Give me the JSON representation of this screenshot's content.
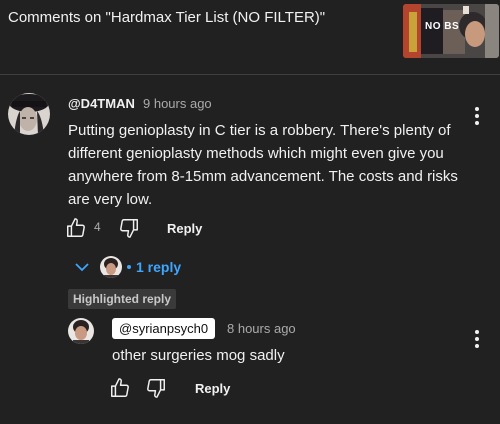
{
  "header": {
    "title": "Comments on \"Hardmax Tier List (NO FILTER)\"",
    "thumbnail_text": "NO BS"
  },
  "comment": {
    "author": "@D4TMAN",
    "time": "9 hours ago",
    "text": "Putting genioplasty in C tier is a robbery.  There's plenty of different genioplasty methods which might even give you anywhere from 8-15mm advancement. The costs and risks are very low.",
    "like_count": "4",
    "reply_label": "Reply",
    "replies_label": "1 reply"
  },
  "reply": {
    "badge": "Highlighted reply",
    "author": "@syrianpsych0",
    "time": "8 hours ago",
    "text": "other surgeries mog sadly",
    "reply_label": "Reply"
  },
  "colors": {
    "background": "#212121",
    "link_blue": "#3ea6ff",
    "secondary_text": "#aaaaaa"
  }
}
